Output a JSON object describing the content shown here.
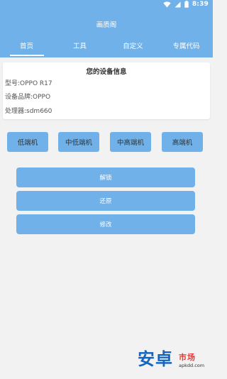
{
  "status": {
    "time": "8:39"
  },
  "app": {
    "title": "画质阁"
  },
  "tabs": [
    {
      "label": "首页",
      "active": true
    },
    {
      "label": "工具",
      "active": false
    },
    {
      "label": "自定义",
      "active": false
    },
    {
      "label": "专属代码",
      "active": false
    }
  ],
  "device_info": {
    "title": "您的设备信息",
    "model": "型号:OPPO R17",
    "brand": "设备品牌:OPPO",
    "processor": "处理器:sdm660"
  },
  "tiers": [
    "低端机",
    "中低端机",
    "中高端机",
    "高端机"
  ],
  "actions": [
    "解锁",
    "还原",
    "修改"
  ],
  "watermark": {
    "main": "安卓",
    "market": "市场",
    "url": "apkdd.com"
  },
  "colors": {
    "accent": "#6fb1e8",
    "background": "#f2f2f2"
  },
  "icons": [
    "wifi-icon",
    "signal-icon",
    "battery-icon"
  ]
}
